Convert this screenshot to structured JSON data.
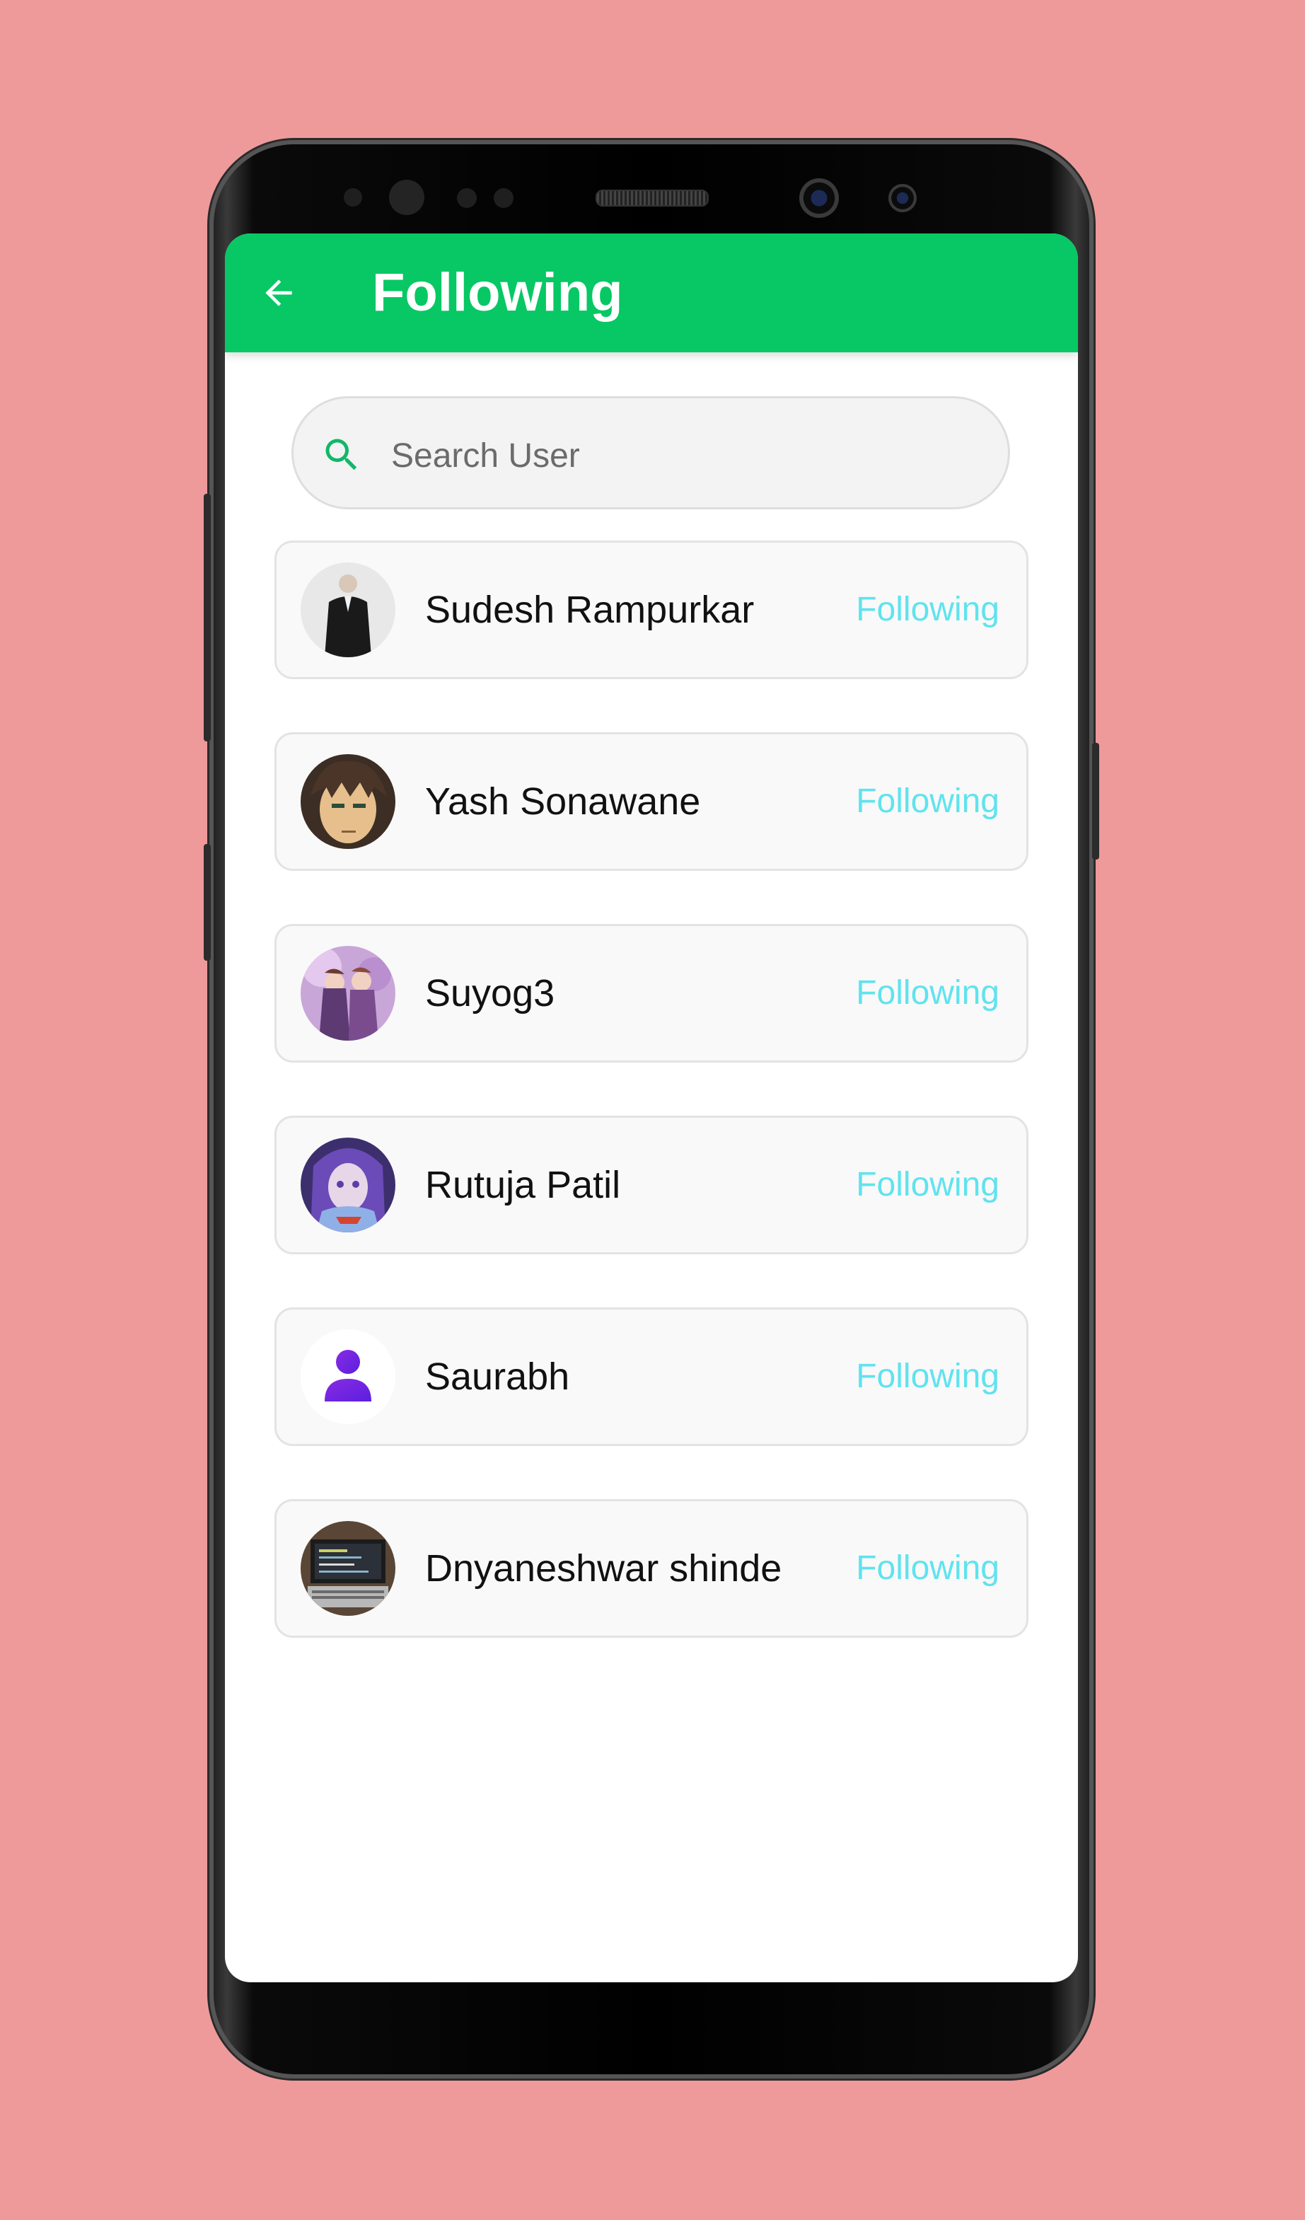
{
  "appbar": {
    "title": "Following",
    "color": "#07c864"
  },
  "search": {
    "placeholder": "Search User",
    "value": ""
  },
  "follow_color": "#5fe3ef",
  "users": [
    {
      "name": "Sudesh Rampurkar",
      "action": "Following",
      "avatar": "photo-avatar"
    },
    {
      "name": "Yash Sonawane",
      "action": "Following",
      "avatar": "anime-avatar"
    },
    {
      "name": "Suyog3",
      "action": "Following",
      "avatar": "anime-avatar"
    },
    {
      "name": "Rutuja Patil",
      "action": "Following",
      "avatar": "anime-avatar"
    },
    {
      "name": "Saurabh",
      "action": "Following",
      "avatar": "default-person-icon"
    },
    {
      "name": "Dnyaneshwar shinde",
      "action": "Following",
      "avatar": "photo-avatar"
    }
  ]
}
